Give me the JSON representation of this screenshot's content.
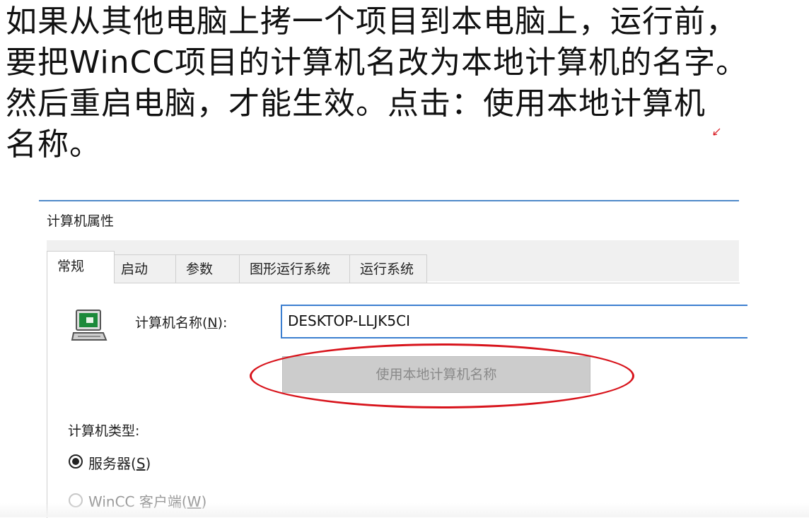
{
  "instructions": {
    "line1": "如果从其他电脑上拷一个项目到本电脑上，运行前，",
    "line2": "要把WinCC项目的计算机名改为本地计算机的名字。",
    "line3": "然后重启电脑，才能生效。点击：使用本地计算机",
    "line4": "名称。"
  },
  "dialog": {
    "title": "计算机属性",
    "tabs": [
      "常规",
      "启动",
      "参数",
      "图形运行系统",
      "运行系统"
    ],
    "active_tab": "常规",
    "computer_icon": "computer-icon",
    "name_label": "计算机名称(N):",
    "name_label_prefix": "计算机名称(",
    "name_label_key": "N",
    "name_label_suffix": "):",
    "name_value": "DESKTOP-LLJK5CI",
    "use_local_button": "使用本地计算机名称",
    "use_local_button_state": "disabled",
    "type_label": "计算机类型:",
    "radio_server_prefix": "服务器(",
    "radio_server_key": "S",
    "radio_server_suffix": ")",
    "radio_server_checked": true,
    "radio_client_prefix": "WinCC 客户端(",
    "radio_client_key": "W",
    "radio_client_suffix": ")",
    "radio_client_checked": false
  },
  "annotation": {
    "highlight_color": "#d8141c",
    "accent_color": "#3c7fd0"
  }
}
